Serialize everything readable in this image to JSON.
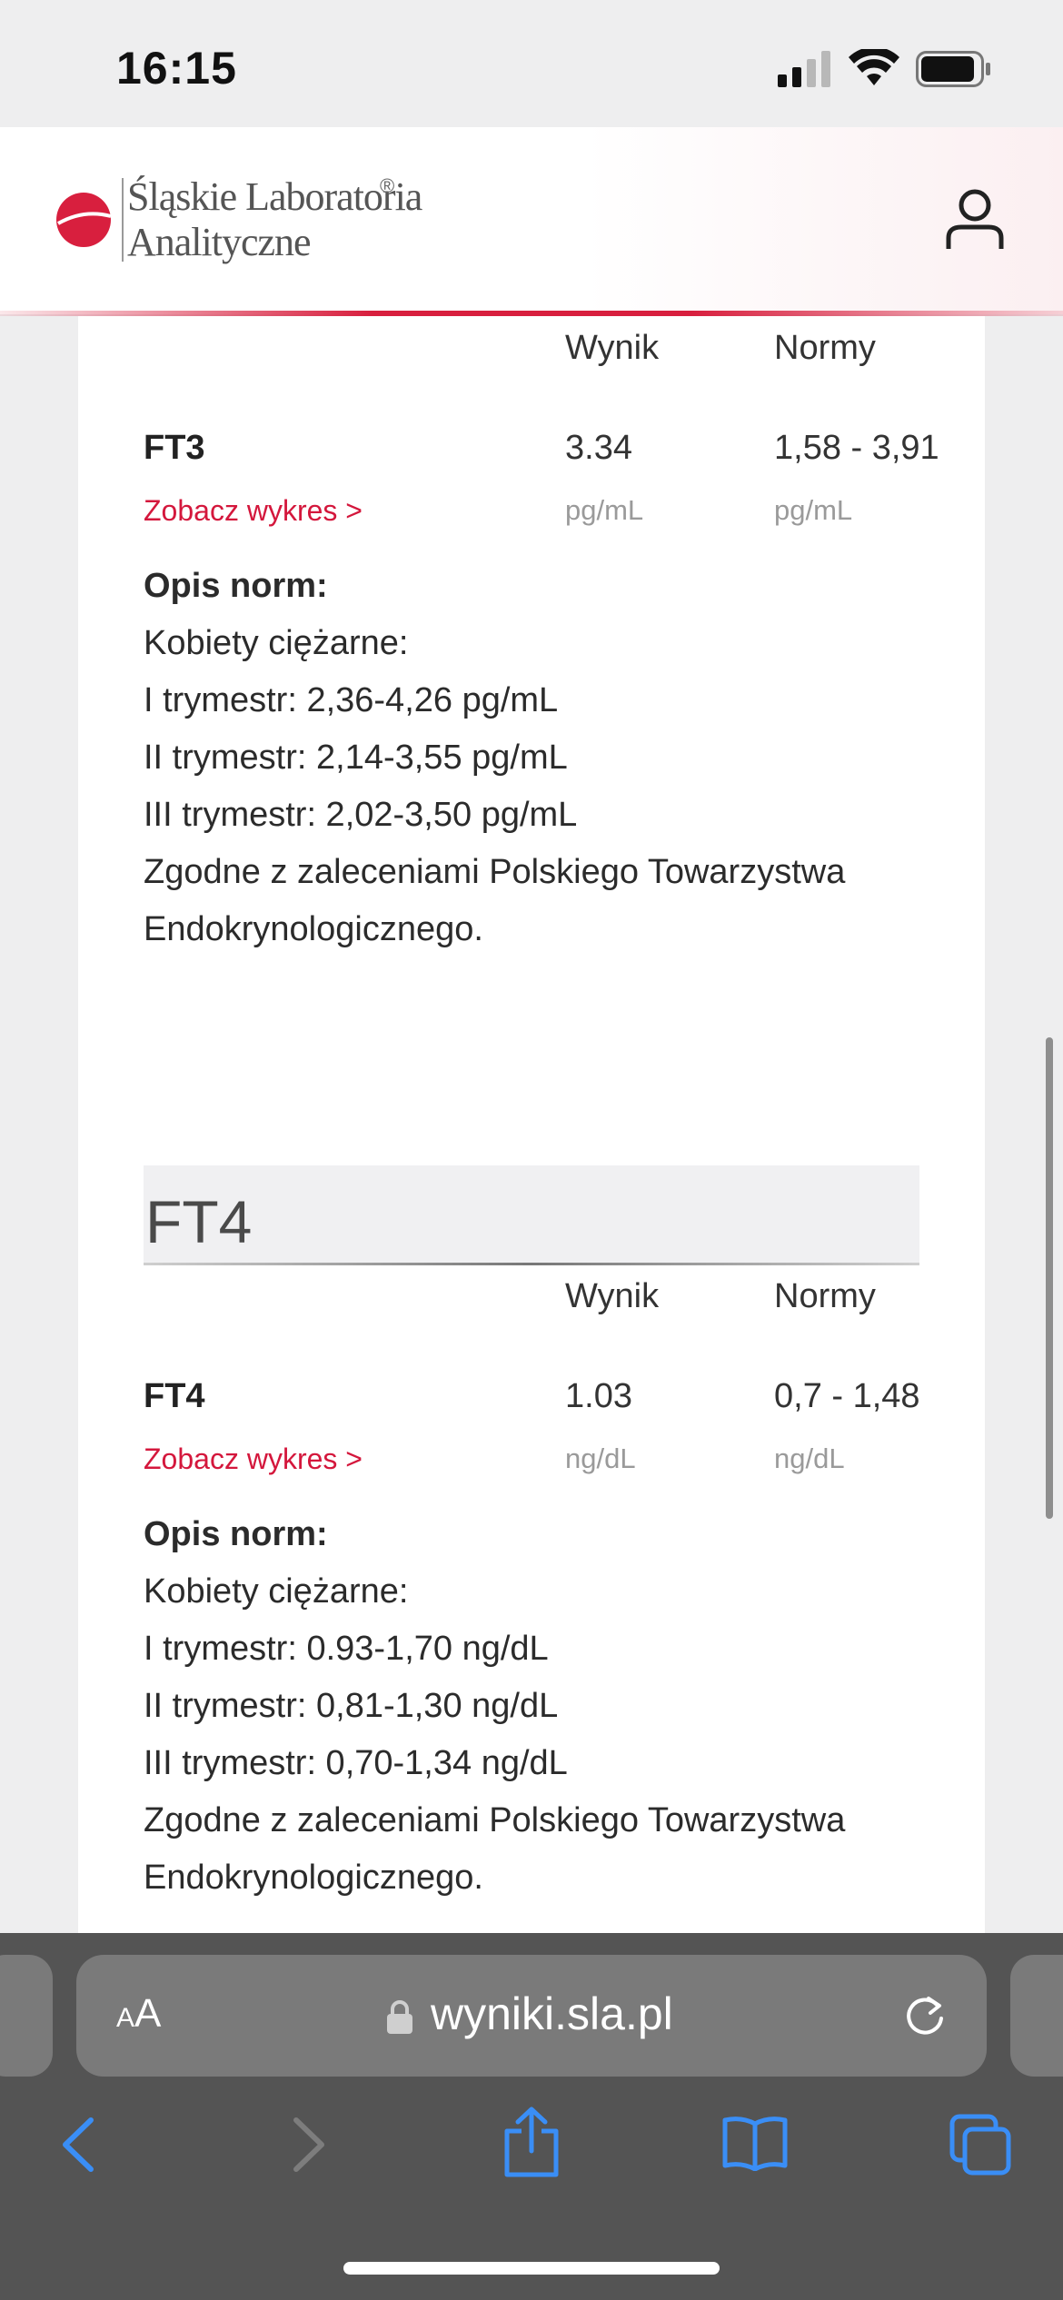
{
  "status_bar": {
    "time": "16:15"
  },
  "header": {
    "logo_line1": "Śląskie Laboratoria",
    "logo_line2": "Analityczne",
    "logo_reg": "®"
  },
  "columns": {
    "result": "Wynik",
    "norms": "Normy"
  },
  "tests": [
    {
      "name": "FT3",
      "chart_link": "Zobacz wykres >",
      "value": "3.34",
      "value_unit": "pg/mL",
      "range": "1,58 - 3,91",
      "range_unit": "pg/mL",
      "norms_title": "Opis norm:",
      "norms_lines": [
        "Kobiety ciężarne:",
        "I trymestr: 2,36-4,26 pg/mL",
        "II trymestr: 2,14-3,55 pg/mL",
        "III trymestr: 2,02-3,50 pg/mL",
        "Zgodne z zaleceniami Polskiego Towarzystwa",
        "Endokrynologicznego."
      ]
    },
    {
      "section_title": "FT4",
      "name": "FT4",
      "chart_link": "Zobacz wykres >",
      "value": "1.03",
      "value_unit": "ng/dL",
      "range": "0,7 - 1,48",
      "range_unit": "ng/dL",
      "norms_title": "Opis norm:",
      "norms_lines": [
        "Kobiety ciężarne:",
        "I trymestr: 0.93-1,70 ng/dL",
        "II trymestr: 0,81-1,30 ng/dL",
        "III trymestr: 0,70-1,34 ng/dL",
        "Zgodne z zaleceniami Polskiego Towarzystwa",
        "Endokrynologicznego."
      ]
    }
  ],
  "browser": {
    "aa_small": "A",
    "aa_large": "A",
    "url": "wyniki.sla.pl"
  },
  "colors": {
    "accent": "#d4173c",
    "browser_bar": "#545454",
    "ios_blue": "#3a8ef6"
  }
}
